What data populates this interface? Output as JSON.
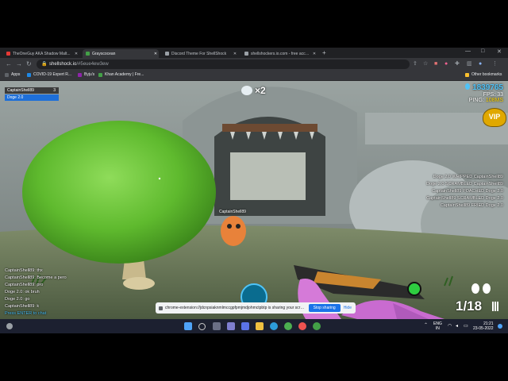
{
  "browser": {
    "tabs": [
      {
        "title": "TheOneGuy AKA Shadow Malt...",
        "active": false,
        "favicon_color": "#e53935"
      },
      {
        "title": "Grayscocean",
        "active": true,
        "favicon_color": "#43a047"
      },
      {
        "title": "Discord Theme For ShellShock",
        "active": false,
        "favicon_color": "#9aa0a6"
      },
      {
        "title": "shellshockers.io.com - free accou...",
        "active": false,
        "favicon_color": "#9aa0a6"
      }
    ],
    "new_tab": "+",
    "window_controls": {
      "minimize": "—",
      "maximize": "□",
      "close": "✕"
    },
    "address": {
      "host": "shellshock.io",
      "path": "/#5eue4ew3ew"
    },
    "bookmarks": [
      {
        "label": "Apps",
        "color": "#5f6368"
      },
      {
        "label": "COVID-19 Expert R...",
        "color": "#1e88e5"
      },
      {
        "label": "Byju's",
        "color": "#8e24aa"
      },
      {
        "label": "Khan Academy | Fre...",
        "color": "#43a047"
      }
    ],
    "other_bookmarks": "Other bookmarks"
  },
  "game": {
    "team": [
      {
        "name": "CaptainShell89",
        "score": "3",
        "color": "#3b3b3b"
      },
      {
        "name": "Doge 2.0",
        "score": "",
        "color": "#1e6fd9"
      }
    ],
    "kill_streak": "×2",
    "score": "1839765",
    "fps": "FPS: 33",
    "ping_label": "PING:",
    "ping_value": "108MS",
    "vip": "VIP",
    "enemy_name": "CaptainShell89",
    "killfeed": [
      "Doge 2.0 WHIPPED CaptainShell89",
      "Doge 2.0 SCRAMBLED CaptainShell89",
      "CaptainShell89 POACHED Doge 2.0",
      "CaptainShell89 SCRAMBLED Doge 2.0",
      "CaptainShell89 FRIED Doge 2.0"
    ],
    "chat": [
      {
        "text": "CaptainShell89: thx",
        "color": "#ffffff"
      },
      {
        "text": "CaptainShell89: Become a pero",
        "color": "#ffffff"
      },
      {
        "text": "CaptainShell89: pro",
        "color": "#ffffff"
      },
      {
        "text": "Doge 2.0: ok bruh",
        "color": "#ffffff"
      },
      {
        "text": "Doge 2.0: go",
        "color": "#ffffff"
      },
      {
        "text": "CaptainShell89: k",
        "color": "#ffffff"
      }
    ],
    "chat_prompt": "Press ENTER to chat",
    "ammo": "1/18",
    "grenades": 2,
    "ability_value": "100",
    "sharing_text": "chrome-extension://jdcnpsiaknmlmccgpfpmjmdjohmctpbtp is sharing your screen.",
    "stop_sharing": "Stop sharing",
    "hide": "Hide"
  },
  "taskbar": {
    "lang_top": "ENG",
    "lang_bottom": "IN",
    "time": "21:21",
    "date": "23-05-2022"
  },
  "colors": {
    "accent": "#1a73e8",
    "chat_prompt": "#4fc3f7",
    "score_blue": "#4fc3f7",
    "ping": "#ffd600"
  }
}
